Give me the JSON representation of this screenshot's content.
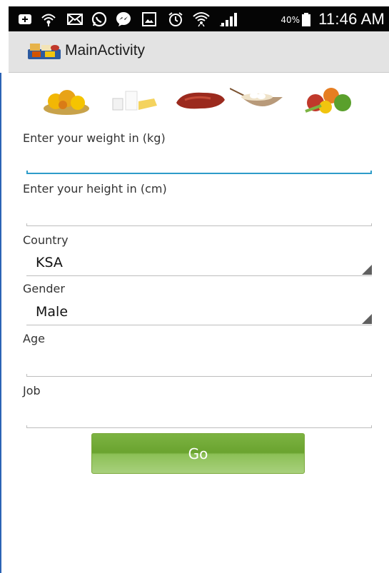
{
  "status_bar": {
    "icons": [
      "plus-box-icon",
      "wifi-hotspot-icon",
      "mail-icon",
      "whatsapp-icon",
      "messenger-icon",
      "gallery-icon",
      "alarm-icon",
      "wifi-icon",
      "signal-icon"
    ],
    "battery_percent": "40%",
    "time": "11:46 AM"
  },
  "action_bar": {
    "title": "MainActivity",
    "icon": "food-app-icon"
  },
  "food_images": [
    "fruits-bowl-icon",
    "milk-cheese-icon",
    "meat-icon",
    "eggs-bowl-icon",
    "vegetables-icon"
  ],
  "form": {
    "weight_label": "Enter your weight in (kg)",
    "weight_value": "",
    "height_label": "Enter your height in (cm)",
    "height_value": "",
    "country_label": "Country",
    "country_value": "KSA",
    "gender_label": "Gender",
    "gender_value": "Male",
    "age_label": "Age",
    "age_value": "",
    "job_label": "Job",
    "job_value": "",
    "go_label": "Go"
  },
  "colors": {
    "status_bar": "#050505",
    "action_bar": "#e3e3e3",
    "focus_underline": "#2e9cc9",
    "button_green": "#7cb342"
  }
}
